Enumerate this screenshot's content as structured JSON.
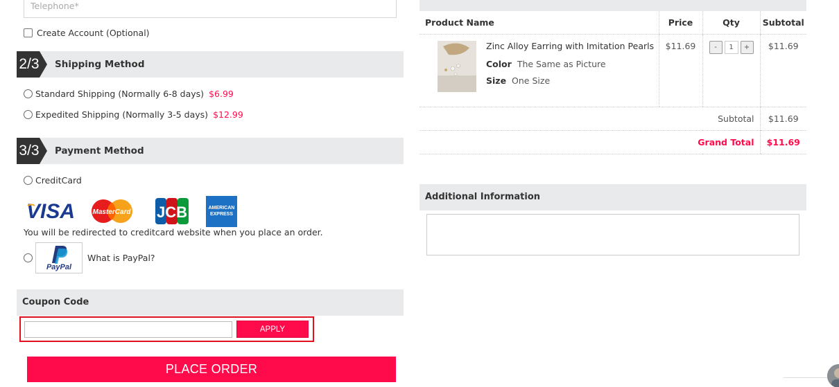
{
  "contact": {
    "telephone_placeholder": "Telephone*",
    "create_account_label": "Create Account (Optional)"
  },
  "shipping": {
    "step": "2/3",
    "title": "Shipping Method",
    "options": [
      {
        "label": "Standard Shipping (Normally 6-8 days)",
        "price": "$6.99"
      },
      {
        "label": "Expedited Shipping (Normally 3-5 days)",
        "price": "$12.99"
      }
    ]
  },
  "payment": {
    "step": "3/3",
    "title": "Payment Method",
    "creditcard_label": "CreditCard",
    "card_logos": [
      "visa-logo",
      "mastercard-logo",
      "jcb-logo",
      "amex-logo"
    ],
    "card_logo_text": {
      "visa": "VISA",
      "mastercard": "MasterCard",
      "jcb": "JCB",
      "amex_line1": "AMERICAN",
      "amex_line2": "EXPRESS"
    },
    "redirect_note": "You will be redirected to creditcard website when you place an order.",
    "paypal_logo_text": "PayPal",
    "paypal_link": "What is PayPal?"
  },
  "coupon": {
    "title": "Coupon Code",
    "input_value": "",
    "apply_label": "APPLY"
  },
  "place_order_label": "PLACE ORDER",
  "order": {
    "columns": [
      "Product Name",
      "Price",
      "Qty",
      "Subtotal"
    ],
    "items": [
      {
        "name": "Zinc Alloy Earring with Imitation Pearls",
        "color_label": "Color",
        "color": "The Same as Picture",
        "size_label": "Size",
        "size": "One Size",
        "price": "$11.69",
        "qty": "1",
        "subtotal": "$11.69"
      }
    ],
    "qty_minus": "-",
    "qty_plus": "+",
    "subtotal_label": "Subtotal",
    "subtotal_value": "$11.69",
    "grand_total_label": "Grand Total",
    "grand_total_value": "$11.69"
  },
  "additional": {
    "title": "Additional Information",
    "value": ""
  },
  "colors": {
    "accent": "#ff0a4b",
    "section_bg": "#e8eaec",
    "step_badge": "#333333",
    "highlight_border": "#e0101e"
  }
}
